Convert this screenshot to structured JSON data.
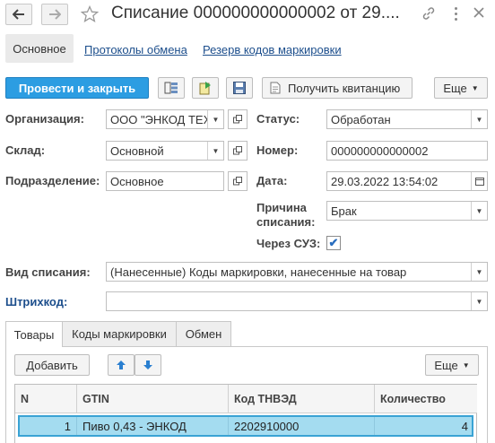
{
  "window": {
    "title": "Списание 000000000000002 от 29....",
    "back_icon": "arrow-left",
    "forward_icon": "arrow-right",
    "favorite_icon": "star",
    "link_icon": "link",
    "menu_icon": "more-vertical",
    "close_icon": "close"
  },
  "nav": {
    "tabs": [
      "Основное",
      "Протоколы обмена",
      "Резерв кодов маркировки"
    ]
  },
  "toolbar": {
    "post_close": "Провести и закрыть",
    "get_receipt": "Получить квитанцию",
    "more": "Еще"
  },
  "form": {
    "org_label": "Организация:",
    "org_value": "ООО \"ЭНКОД ТЕХ",
    "warehouse_label": "Склад:",
    "warehouse_value": "Основной",
    "subdivision_label": "Подразделение:",
    "subdivision_value": "Основное",
    "status_label": "Статус:",
    "status_value": "Обработан",
    "number_label": "Номер:",
    "number_value": "000000000000002",
    "date_label": "Дата:",
    "date_value": "29.03.2022 13:54:02",
    "reason_label_1": "Причина",
    "reason_label_2": "списания:",
    "reason_value": "Брак",
    "suz_label": "Через СУЗ:",
    "suz_checked": true,
    "writeoff_type_label": "Вид списания:",
    "writeoff_type_value": "(Нанесенные) Коды маркировки, нанесенные на товар",
    "barcode_label": "Штрихкод:",
    "barcode_value": ""
  },
  "tabs": [
    "Товары",
    "Коды маркировки",
    "Обмен"
  ],
  "table_toolbar": {
    "add": "Добавить",
    "more": "Еще"
  },
  "table": {
    "headers": [
      "N",
      "GTIN",
      "Код ТНВЭД",
      "Количество"
    ],
    "rows": [
      {
        "n": "1",
        "gtin": "Пиво 0,43 - ЭНКОД",
        "tnved": "2202910000",
        "qty": "4"
      }
    ]
  },
  "colors": {
    "primary": "#2c9de2",
    "link": "#1c4e8c",
    "selected_row": "#a4dcf0"
  }
}
